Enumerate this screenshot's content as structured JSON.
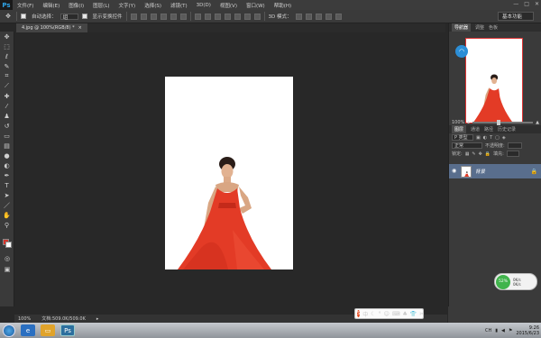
{
  "app": {
    "logo": "Ps"
  },
  "menu": [
    "文件(F)",
    "编辑(E)",
    "图像(I)",
    "图层(L)",
    "文字(Y)",
    "选择(S)",
    "滤镜(T)",
    "3D(D)",
    "视图(V)",
    "窗口(W)",
    "帮助(H)"
  ],
  "window_controls": [
    "—",
    "□",
    "✕"
  ],
  "options": {
    "auto_select_label": "自动选择：",
    "auto_select_value": "组",
    "show_transform_label": "显示变换控件",
    "mode_3d_label": "3D 模式：",
    "workspace": "基本功能"
  },
  "document": {
    "tab_title": "4.jpg @ 100%(RGB/8) *",
    "close": "×"
  },
  "status": {
    "zoom": "100%",
    "doc_size": "文档:509.0K/509.0K"
  },
  "navigator": {
    "tabs": [
      "导航器",
      "调整",
      "色板"
    ],
    "zoom": "100%"
  },
  "layers": {
    "tabs": [
      "图层",
      "通道",
      "路径",
      "历史记录"
    ],
    "filter_label": "P 类型",
    "blend_mode": "正常",
    "opacity_label": "不透明度:",
    "lock_label": "锁定:",
    "fill_label": "填充:",
    "layer_name": "背景"
  },
  "network": {
    "percent": "52%",
    "up": "0K/s",
    "down": "0K/s"
  },
  "ime": {
    "logo": "S",
    "label": "中"
  },
  "taskbar": {
    "app_ps": "Ps",
    "lang": "CH",
    "time": "9:26",
    "date": "2015/6/23"
  },
  "colors": {
    "foreground": "#d4342b",
    "background": "#ffffff",
    "layer_selected": "#596e8d"
  },
  "icons": {
    "wifi": "wifi-icon",
    "eye": "eye-icon",
    "lock": "lock-icon"
  }
}
